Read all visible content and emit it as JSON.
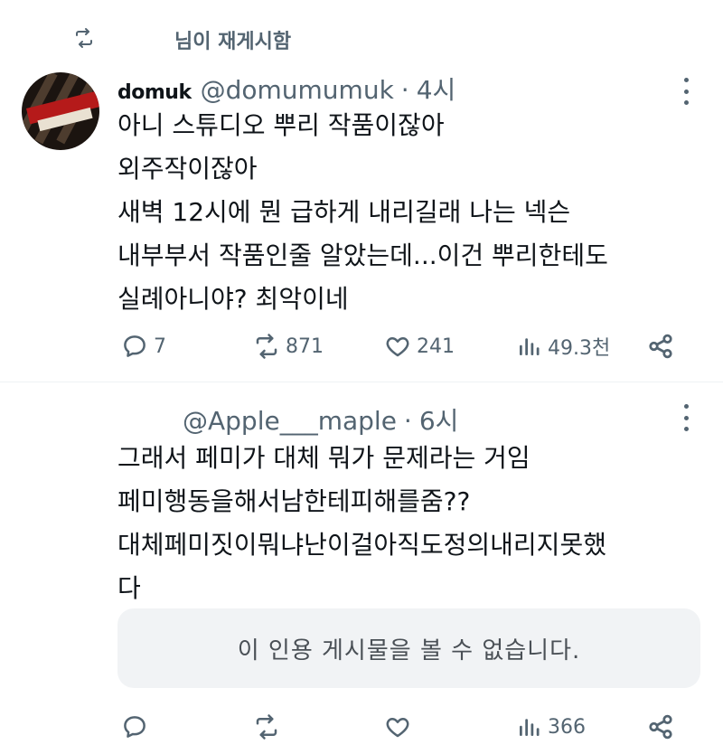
{
  "repost": {
    "label": "님이 재게시함"
  },
  "tweet1": {
    "display_name": "domuk",
    "handle": "@domumumuk",
    "separator": "·",
    "time": "4시",
    "lines": [
      "아니 스튜디오 뿌리 작품이잖아",
      "외주작이잖아",
      "새벽 12시에 뭔 급하게 내리길래 나는 넥슨",
      "내부부서 작품인줄 알았는데...이건 뿌리한테도",
      "실례아니야? 최악이네"
    ],
    "actions": {
      "replies": "7",
      "reposts": "871",
      "likes": "241",
      "views": "49.3천"
    }
  },
  "tweet2": {
    "handle": "@Apple___maple",
    "separator": "·",
    "time": "6시",
    "lines": [
      "그래서 페미가 대체 뭐가 문제라는 거임",
      "페미행동을해서남한테피해를줌??",
      "대체페미짓이뭐냐난이걸아직도정의내리지못했",
      "다"
    ],
    "quote_unavailable": "이 인용 게시물을 볼 수 없습니다.",
    "actions": {
      "replies": "",
      "reposts": "",
      "likes": "",
      "views": "366"
    }
  },
  "icons": {
    "repost": "repost-icon",
    "reply": "reply-icon",
    "like": "heart-icon",
    "views": "views-icon",
    "share": "share-icon",
    "more": "more-icon"
  },
  "colors": {
    "text": "#0f1419",
    "muted": "#536471",
    "divider": "#eff3f4",
    "quote_bg": "#f1f3f5"
  }
}
